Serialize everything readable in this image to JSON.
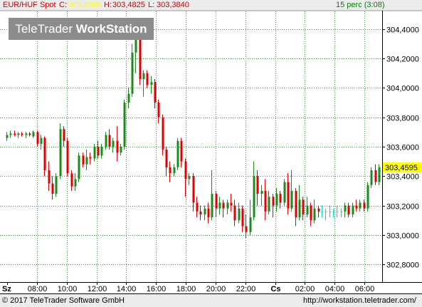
{
  "header": {
    "symbol": "EUR/HUF Spot",
    "close_label": "C:",
    "close_value": "303,4595",
    "high_label": "H:",
    "high_value": "303,4825",
    "low_label": "L:",
    "low_value": "303,3840",
    "interval": "15 perc (3:08)"
  },
  "logo": {
    "part1": "TeleTrader ",
    "part2": "WorkStation"
  },
  "footer": {
    "copyright": "© 2017  TeleTrader Software GmbH",
    "url": "http://workstation.teletrader.com/"
  },
  "colors": {
    "up": "#1a8c1a",
    "down": "#e00000",
    "neutral": "#00d8d8",
    "grid": "#3a9a3a",
    "price_tag": "#ffff00",
    "header_text": "#cc0000",
    "header_value": "#ffff00",
    "interval_text": "#008000"
  },
  "chart_data": {
    "type": "candlestick",
    "title": "EUR/HUF Spot",
    "interval": "15 perc",
    "ylim": [
      302.68,
      304.52
    ],
    "yticks": [
      302.8,
      303.0,
      303.2,
      303.4,
      303.6,
      303.8,
      304.0,
      304.2,
      304.4
    ],
    "ytick_labels": [
      "302,8000",
      "303,0000",
      "303,2000",
      "303,4000",
      "303,6000",
      "303,8000",
      "304,0000",
      "304,2000",
      "304,4000"
    ],
    "last_price": 303.4595,
    "last_price_label": "303,4595",
    "x_labels": [
      "Sz",
      "08:00",
      "10:00",
      "12:00",
      "14:00",
      "16:00",
      "18:00",
      "20:00",
      "22:00",
      "Cs",
      "02:00",
      "04:00",
      "06:00"
    ],
    "grid": true,
    "candles": [
      {
        "o": 303.66,
        "h": 303.7,
        "l": 303.64,
        "c": 303.68
      },
      {
        "o": 303.68,
        "h": 303.71,
        "l": 303.66,
        "c": 303.69
      },
      {
        "o": 303.69,
        "h": 303.71,
        "l": 303.67,
        "c": 303.68
      },
      {
        "o": 303.68,
        "h": 303.7,
        "l": 303.66,
        "c": 303.69
      },
      {
        "o": 303.69,
        "h": 303.7,
        "l": 303.67,
        "c": 303.68
      },
      {
        "o": 303.68,
        "h": 303.7,
        "l": 303.66,
        "c": 303.69
      },
      {
        "o": 303.69,
        "h": 303.7,
        "l": 303.67,
        "c": 303.68
      },
      {
        "o": 303.67,
        "h": 303.71,
        "l": 303.66,
        "c": 303.7
      },
      {
        "o": 303.7,
        "h": 303.71,
        "l": 303.6,
        "c": 303.62
      },
      {
        "o": 303.62,
        "h": 303.68,
        "l": 303.58,
        "c": 303.66
      },
      {
        "o": 303.66,
        "h": 303.67,
        "l": 303.4,
        "c": 303.44
      },
      {
        "o": 303.44,
        "h": 303.5,
        "l": 303.3,
        "c": 303.35
      },
      {
        "o": 303.35,
        "h": 303.4,
        "l": 303.24,
        "c": 303.28
      },
      {
        "o": 303.28,
        "h": 303.42,
        "l": 303.26,
        "c": 303.4
      },
      {
        "o": 303.4,
        "h": 303.76,
        "l": 303.38,
        "c": 303.72
      },
      {
        "o": 303.72,
        "h": 303.74,
        "l": 303.6,
        "c": 303.64
      },
      {
        "o": 303.64,
        "h": 303.66,
        "l": 303.4,
        "c": 303.42
      },
      {
        "o": 303.42,
        "h": 303.44,
        "l": 303.3,
        "c": 303.33
      },
      {
        "o": 303.33,
        "h": 303.42,
        "l": 303.3,
        "c": 303.38
      },
      {
        "o": 303.38,
        "h": 303.56,
        "l": 303.36,
        "c": 303.54
      },
      {
        "o": 303.54,
        "h": 303.56,
        "l": 303.46,
        "c": 303.48
      },
      {
        "o": 303.48,
        "h": 303.58,
        "l": 303.44,
        "c": 303.53
      },
      {
        "o": 303.53,
        "h": 303.56,
        "l": 303.48,
        "c": 303.52
      },
      {
        "o": 303.52,
        "h": 303.62,
        "l": 303.5,
        "c": 303.6
      },
      {
        "o": 303.6,
        "h": 303.64,
        "l": 303.52,
        "c": 303.54
      },
      {
        "o": 303.54,
        "h": 303.62,
        "l": 303.52,
        "c": 303.6
      },
      {
        "o": 303.6,
        "h": 303.7,
        "l": 303.58,
        "c": 303.68
      },
      {
        "o": 303.68,
        "h": 303.72,
        "l": 303.58,
        "c": 303.6
      },
      {
        "o": 303.6,
        "h": 303.66,
        "l": 303.56,
        "c": 303.64
      },
      {
        "o": 303.64,
        "h": 303.74,
        "l": 303.5,
        "c": 303.56
      },
      {
        "o": 303.56,
        "h": 303.62,
        "l": 303.54,
        "c": 303.6
      },
      {
        "o": 303.6,
        "h": 303.92,
        "l": 303.58,
        "c": 303.9
      },
      {
        "o": 303.9,
        "h": 304.0,
        "l": 303.86,
        "c": 303.96
      },
      {
        "o": 303.96,
        "h": 304.3,
        "l": 303.94,
        "c": 304.24
      },
      {
        "o": 304.24,
        "h": 304.4,
        "l": 304.1,
        "c": 304.35
      },
      {
        "o": 304.35,
        "h": 304.38,
        "l": 304.02,
        "c": 304.06
      },
      {
        "o": 304.06,
        "h": 304.12,
        "l": 303.94,
        "c": 304.1
      },
      {
        "o": 304.1,
        "h": 304.12,
        "l": 304.0,
        "c": 304.02
      },
      {
        "o": 304.02,
        "h": 304.08,
        "l": 303.96,
        "c": 304.04
      },
      {
        "o": 304.04,
        "h": 304.06,
        "l": 303.86,
        "c": 303.9
      },
      {
        "o": 303.9,
        "h": 303.92,
        "l": 303.76,
        "c": 303.8
      },
      {
        "o": 303.8,
        "h": 303.82,
        "l": 303.54,
        "c": 303.58
      },
      {
        "o": 303.58,
        "h": 303.6,
        "l": 303.4,
        "c": 303.46
      },
      {
        "o": 303.46,
        "h": 303.5,
        "l": 303.36,
        "c": 303.42
      },
      {
        "o": 303.42,
        "h": 303.48,
        "l": 303.4,
        "c": 303.46
      },
      {
        "o": 303.46,
        "h": 303.66,
        "l": 303.44,
        "c": 303.64
      },
      {
        "o": 303.64,
        "h": 303.66,
        "l": 303.46,
        "c": 303.5
      },
      {
        "o": 303.5,
        "h": 303.52,
        "l": 303.26,
        "c": 303.38
      },
      {
        "o": 303.38,
        "h": 303.42,
        "l": 303.34,
        "c": 303.4
      },
      {
        "o": 303.4,
        "h": 303.42,
        "l": 303.16,
        "c": 303.22
      },
      {
        "o": 303.22,
        "h": 303.26,
        "l": 303.12,
        "c": 303.16
      },
      {
        "o": 303.16,
        "h": 303.2,
        "l": 303.1,
        "c": 303.14
      },
      {
        "o": 303.14,
        "h": 303.2,
        "l": 303.1,
        "c": 303.18
      },
      {
        "o": 303.18,
        "h": 303.22,
        "l": 303.08,
        "c": 303.12
      },
      {
        "o": 303.12,
        "h": 303.44,
        "l": 303.1,
        "c": 303.28
      },
      {
        "o": 303.28,
        "h": 303.3,
        "l": 303.12,
        "c": 303.18
      },
      {
        "o": 303.18,
        "h": 303.26,
        "l": 303.14,
        "c": 303.22
      },
      {
        "o": 303.22,
        "h": 303.24,
        "l": 303.12,
        "c": 303.18
      },
      {
        "o": 303.18,
        "h": 303.24,
        "l": 303.14,
        "c": 303.22
      },
      {
        "o": 303.22,
        "h": 303.28,
        "l": 303.16,
        "c": 303.2
      },
      {
        "o": 303.2,
        "h": 303.24,
        "l": 303.06,
        "c": 303.1
      },
      {
        "o": 303.1,
        "h": 303.22,
        "l": 303.08,
        "c": 303.18
      },
      {
        "o": 303.18,
        "h": 303.2,
        "l": 303.02,
        "c": 303.06
      },
      {
        "o": 303.06,
        "h": 303.14,
        "l": 302.98,
        "c": 303.02
      },
      {
        "o": 303.02,
        "h": 303.24,
        "l": 303.0,
        "c": 303.12
      },
      {
        "o": 303.12,
        "h": 303.5,
        "l": 303.1,
        "c": 303.4
      },
      {
        "o": 303.4,
        "h": 303.44,
        "l": 303.2,
        "c": 303.28
      },
      {
        "o": 303.28,
        "h": 303.34,
        "l": 303.2,
        "c": 303.3
      },
      {
        "o": 303.3,
        "h": 303.38,
        "l": 303.1,
        "c": 303.16
      },
      {
        "o": 303.16,
        "h": 303.3,
        "l": 303.14,
        "c": 303.26
      },
      {
        "o": 303.26,
        "h": 303.28,
        "l": 303.12,
        "c": 303.2
      },
      {
        "o": 303.2,
        "h": 303.32,
        "l": 303.16,
        "c": 303.28
      },
      {
        "o": 303.28,
        "h": 303.3,
        "l": 303.18,
        "c": 303.22
      },
      {
        "o": 303.22,
        "h": 303.38,
        "l": 303.2,
        "c": 303.36
      },
      {
        "o": 303.36,
        "h": 303.42,
        "l": 303.14,
        "c": 303.18
      },
      {
        "o": 303.18,
        "h": 303.44,
        "l": 303.16,
        "c": 303.3
      },
      {
        "o": 303.3,
        "h": 303.32,
        "l": 303.06,
        "c": 303.12
      },
      {
        "o": 303.12,
        "h": 303.34,
        "l": 303.1,
        "c": 303.24
      },
      {
        "o": 303.24,
        "h": 303.26,
        "l": 303.1,
        "c": 303.14
      },
      {
        "o": 303.14,
        "h": 303.26,
        "l": 303.12,
        "c": 303.2
      },
      {
        "o": 303.2,
        "h": 303.22,
        "l": 303.06,
        "c": 303.1
      },
      {
        "o": 303.1,
        "h": 303.24,
        "l": 303.08,
        "c": 303.18
      },
      {
        "o": 303.18,
        "h": 303.2,
        "l": 303.12,
        "c": 303.16
      },
      {
        "o": 303.16,
        "h": 303.2,
        "l": 303.12,
        "c": 303.16
      },
      {
        "o": 303.16,
        "h": 303.18,
        "l": 303.1,
        "c": 303.16
      },
      {
        "o": 303.16,
        "h": 303.2,
        "l": 303.12,
        "c": 303.16
      },
      {
        "o": 303.16,
        "h": 303.18,
        "l": 303.12,
        "c": 303.16
      },
      {
        "o": 303.16,
        "h": 303.2,
        "l": 303.12,
        "c": 303.16
      },
      {
        "o": 303.16,
        "h": 303.18,
        "l": 303.12,
        "c": 303.16
      },
      {
        "o": 303.16,
        "h": 303.22,
        "l": 303.12,
        "c": 303.2
      },
      {
        "o": 303.2,
        "h": 303.22,
        "l": 303.12,
        "c": 303.14
      },
      {
        "o": 303.14,
        "h": 303.22,
        "l": 303.12,
        "c": 303.2
      },
      {
        "o": 303.2,
        "h": 303.24,
        "l": 303.16,
        "c": 303.18
      },
      {
        "o": 303.18,
        "h": 303.24,
        "l": 303.16,
        "c": 303.22
      },
      {
        "o": 303.22,
        "h": 303.24,
        "l": 303.16,
        "c": 303.18
      },
      {
        "o": 303.18,
        "h": 303.36,
        "l": 303.16,
        "c": 303.34
      },
      {
        "o": 303.34,
        "h": 303.46,
        "l": 303.32,
        "c": 303.44
      },
      {
        "o": 303.44,
        "h": 303.48,
        "l": 303.34,
        "c": 303.36
      },
      {
        "o": 303.36,
        "h": 303.48,
        "l": 303.34,
        "c": 303.46
      }
    ]
  }
}
